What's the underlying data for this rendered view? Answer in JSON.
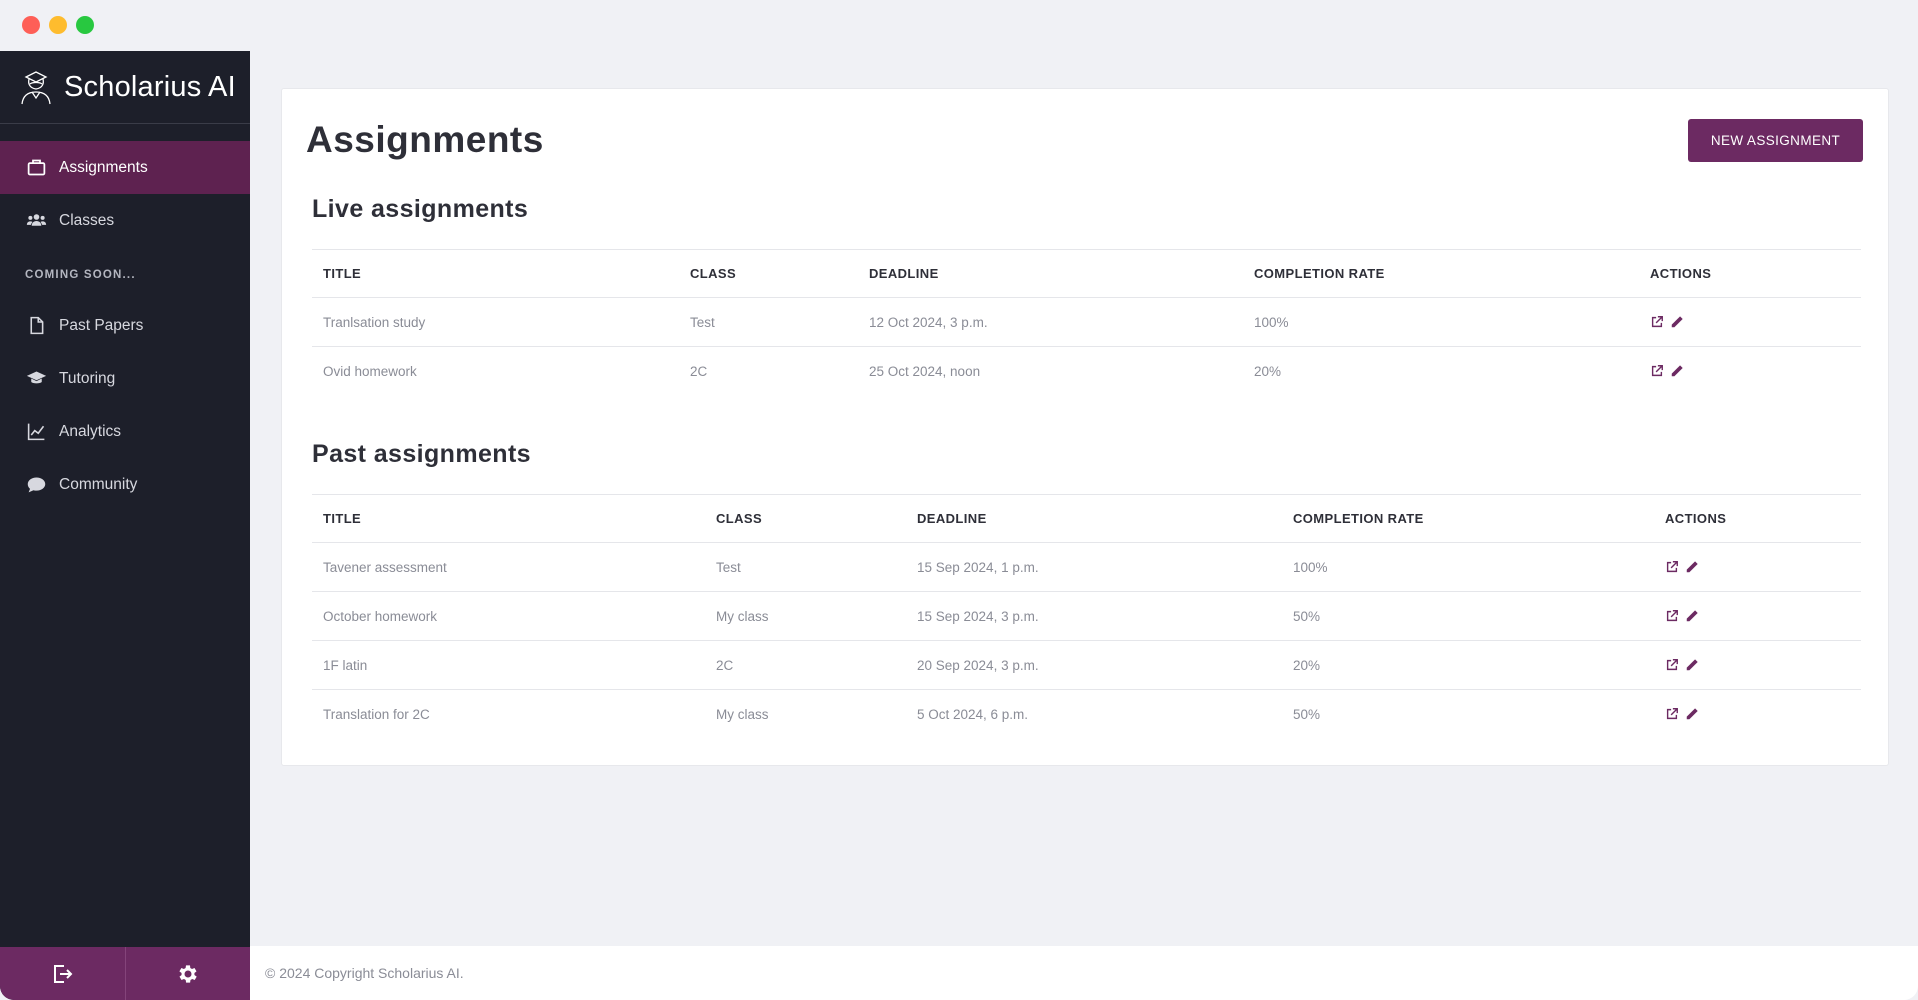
{
  "brand": {
    "name": "Scholarius AI"
  },
  "sidebar": {
    "items": [
      {
        "label": "Assignments",
        "icon": "briefcase-icon",
        "active": true
      },
      {
        "label": "Classes",
        "icon": "users-icon",
        "active": false
      }
    ],
    "section_label": "COMING SOON...",
    "soon_items": [
      {
        "label": "Past Papers",
        "icon": "file-icon"
      },
      {
        "label": "Tutoring",
        "icon": "graduation-cap-icon"
      },
      {
        "label": "Analytics",
        "icon": "line-chart-icon"
      },
      {
        "label": "Community",
        "icon": "chat-bubble-icon"
      }
    ],
    "footer": {
      "logout_icon": "logout-icon",
      "settings_icon": "gear-icon"
    }
  },
  "main": {
    "title": "Assignments",
    "new_button": "NEW ASSIGNMENT",
    "live": {
      "title": "Live assignments",
      "headers": [
        "TITLE",
        "CLASS",
        "DEADLINE",
        "COMPLETION RATE",
        "ACTIONS"
      ],
      "rows": [
        {
          "title": "Tranlsation study",
          "class": "Test",
          "deadline": "12 Oct 2024, 3 p.m.",
          "rate": "100%"
        },
        {
          "title": "Ovid homework",
          "class": "2C",
          "deadline": "25 Oct 2024, noon",
          "rate": "20%"
        }
      ]
    },
    "past": {
      "title": "Past assignments",
      "headers": [
        "TITLE",
        "CLASS",
        "DEADLINE",
        "COMPLETION RATE",
        "ACTIONS"
      ],
      "rows": [
        {
          "title": "Tavener assessment",
          "class": "Test",
          "deadline": "15 Sep 2024, 1 p.m.",
          "rate": "100%"
        },
        {
          "title": "October homework",
          "class": "My class",
          "deadline": "15 Sep 2024, 3 p.m.",
          "rate": "50%"
        },
        {
          "title": "1F latin",
          "class": "2C",
          "deadline": "20 Sep 2024, 3 p.m.",
          "rate": "20%"
        },
        {
          "title": "Translation for 2C",
          "class": "My class",
          "deadline": "5 Oct 2024, 6 p.m.",
          "rate": "50%"
        }
      ]
    }
  },
  "footer": {
    "copyright": "© 2024 Copyright Scholarius AI."
  },
  "colors": {
    "accent": "#6c2a62",
    "sidebar_bg": "#1d1f2a",
    "active_bg": "#5e2250"
  }
}
